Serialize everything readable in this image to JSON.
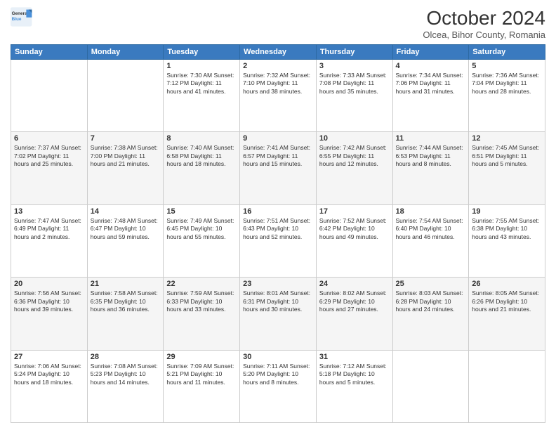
{
  "header": {
    "logo_line1": "General",
    "logo_line2": "Blue",
    "month": "October 2024",
    "location": "Olcea, Bihor County, Romania"
  },
  "days_of_week": [
    "Sunday",
    "Monday",
    "Tuesday",
    "Wednesday",
    "Thursday",
    "Friday",
    "Saturday"
  ],
  "weeks": [
    [
      {
        "day": "",
        "content": ""
      },
      {
        "day": "",
        "content": ""
      },
      {
        "day": "1",
        "content": "Sunrise: 7:30 AM\nSunset: 7:12 PM\nDaylight: 11 hours and 41 minutes."
      },
      {
        "day": "2",
        "content": "Sunrise: 7:32 AM\nSunset: 7:10 PM\nDaylight: 11 hours and 38 minutes."
      },
      {
        "day": "3",
        "content": "Sunrise: 7:33 AM\nSunset: 7:08 PM\nDaylight: 11 hours and 35 minutes."
      },
      {
        "day": "4",
        "content": "Sunrise: 7:34 AM\nSunset: 7:06 PM\nDaylight: 11 hours and 31 minutes."
      },
      {
        "day": "5",
        "content": "Sunrise: 7:36 AM\nSunset: 7:04 PM\nDaylight: 11 hours and 28 minutes."
      }
    ],
    [
      {
        "day": "6",
        "content": "Sunrise: 7:37 AM\nSunset: 7:02 PM\nDaylight: 11 hours and 25 minutes."
      },
      {
        "day": "7",
        "content": "Sunrise: 7:38 AM\nSunset: 7:00 PM\nDaylight: 11 hours and 21 minutes."
      },
      {
        "day": "8",
        "content": "Sunrise: 7:40 AM\nSunset: 6:58 PM\nDaylight: 11 hours and 18 minutes."
      },
      {
        "day": "9",
        "content": "Sunrise: 7:41 AM\nSunset: 6:57 PM\nDaylight: 11 hours and 15 minutes."
      },
      {
        "day": "10",
        "content": "Sunrise: 7:42 AM\nSunset: 6:55 PM\nDaylight: 11 hours and 12 minutes."
      },
      {
        "day": "11",
        "content": "Sunrise: 7:44 AM\nSunset: 6:53 PM\nDaylight: 11 hours and 8 minutes."
      },
      {
        "day": "12",
        "content": "Sunrise: 7:45 AM\nSunset: 6:51 PM\nDaylight: 11 hours and 5 minutes."
      }
    ],
    [
      {
        "day": "13",
        "content": "Sunrise: 7:47 AM\nSunset: 6:49 PM\nDaylight: 11 hours and 2 minutes."
      },
      {
        "day": "14",
        "content": "Sunrise: 7:48 AM\nSunset: 6:47 PM\nDaylight: 10 hours and 59 minutes."
      },
      {
        "day": "15",
        "content": "Sunrise: 7:49 AM\nSunset: 6:45 PM\nDaylight: 10 hours and 55 minutes."
      },
      {
        "day": "16",
        "content": "Sunrise: 7:51 AM\nSunset: 6:43 PM\nDaylight: 10 hours and 52 minutes."
      },
      {
        "day": "17",
        "content": "Sunrise: 7:52 AM\nSunset: 6:42 PM\nDaylight: 10 hours and 49 minutes."
      },
      {
        "day": "18",
        "content": "Sunrise: 7:54 AM\nSunset: 6:40 PM\nDaylight: 10 hours and 46 minutes."
      },
      {
        "day": "19",
        "content": "Sunrise: 7:55 AM\nSunset: 6:38 PM\nDaylight: 10 hours and 43 minutes."
      }
    ],
    [
      {
        "day": "20",
        "content": "Sunrise: 7:56 AM\nSunset: 6:36 PM\nDaylight: 10 hours and 39 minutes."
      },
      {
        "day": "21",
        "content": "Sunrise: 7:58 AM\nSunset: 6:35 PM\nDaylight: 10 hours and 36 minutes."
      },
      {
        "day": "22",
        "content": "Sunrise: 7:59 AM\nSunset: 6:33 PM\nDaylight: 10 hours and 33 minutes."
      },
      {
        "day": "23",
        "content": "Sunrise: 8:01 AM\nSunset: 6:31 PM\nDaylight: 10 hours and 30 minutes."
      },
      {
        "day": "24",
        "content": "Sunrise: 8:02 AM\nSunset: 6:29 PM\nDaylight: 10 hours and 27 minutes."
      },
      {
        "day": "25",
        "content": "Sunrise: 8:03 AM\nSunset: 6:28 PM\nDaylight: 10 hours and 24 minutes."
      },
      {
        "day": "26",
        "content": "Sunrise: 8:05 AM\nSunset: 6:26 PM\nDaylight: 10 hours and 21 minutes."
      }
    ],
    [
      {
        "day": "27",
        "content": "Sunrise: 7:06 AM\nSunset: 5:24 PM\nDaylight: 10 hours and 18 minutes."
      },
      {
        "day": "28",
        "content": "Sunrise: 7:08 AM\nSunset: 5:23 PM\nDaylight: 10 hours and 14 minutes."
      },
      {
        "day": "29",
        "content": "Sunrise: 7:09 AM\nSunset: 5:21 PM\nDaylight: 10 hours and 11 minutes."
      },
      {
        "day": "30",
        "content": "Sunrise: 7:11 AM\nSunset: 5:20 PM\nDaylight: 10 hours and 8 minutes."
      },
      {
        "day": "31",
        "content": "Sunrise: 7:12 AM\nSunset: 5:18 PM\nDaylight: 10 hours and 5 minutes."
      },
      {
        "day": "",
        "content": ""
      },
      {
        "day": "",
        "content": ""
      }
    ]
  ]
}
